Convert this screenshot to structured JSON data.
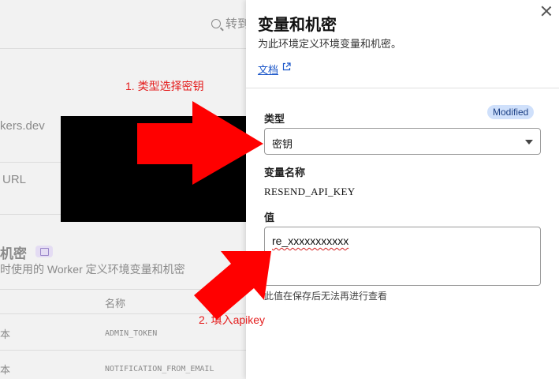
{
  "background": {
    "search_text": "转到",
    "row1_text": "kers.dev",
    "row2_text": "URL",
    "section_title": "机密",
    "section_desc": "时使用的 Worker 定义环境变量和机密",
    "column_header": "名称",
    "rows": [
      {
        "prefix": "本",
        "name": "ADMIN_TOKEN"
      },
      {
        "prefix": "本",
        "name": "NOTIFICATION_FROM_EMAIL"
      }
    ]
  },
  "drawer": {
    "title": "变量和机密",
    "subtitle": "为此环境定义环境变量和机密。",
    "docs_link": "文档",
    "type_label": "类型",
    "modified_badge": "Modified",
    "type_value": "密钥",
    "var_name_label": "变量名称",
    "var_name_value": "RESEND_API_KEY",
    "value_label": "值",
    "value_text": "re_xxxxxxxxxxx",
    "hint": "此值在保存后无法再进行查看"
  },
  "annotations": {
    "step1": "1. 类型选择密钥",
    "step2": "2. 填入apikey",
    "color": "#e41d1d"
  },
  "colors": {
    "badge_bg": "#cfe0fb",
    "link": "#1a56c9",
    "arrow": "#ff0000"
  }
}
